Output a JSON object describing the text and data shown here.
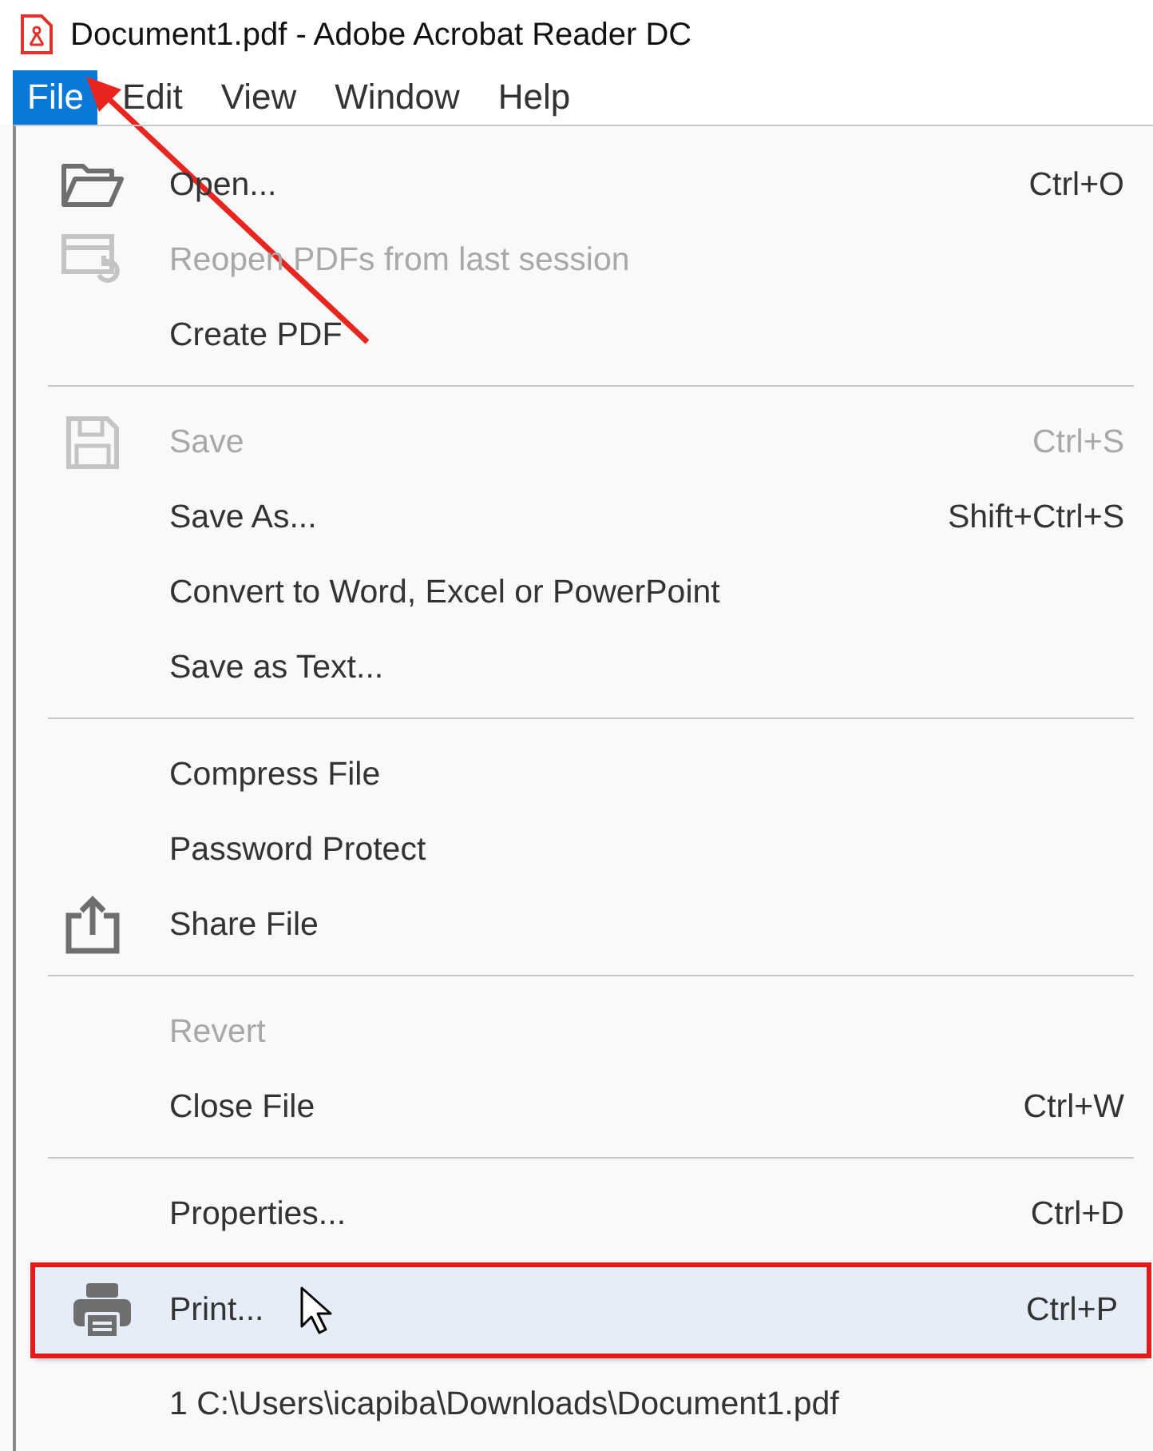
{
  "window": {
    "title": "Document1.pdf - Adobe Acrobat Reader DC"
  },
  "menu_bar": [
    {
      "label": "File",
      "selected": true
    },
    {
      "label": "Edit",
      "selected": false
    },
    {
      "label": "View",
      "selected": false
    },
    {
      "label": "Window",
      "selected": false
    },
    {
      "label": "Help",
      "selected": false
    }
  ],
  "file_menu": {
    "sections": [
      [
        {
          "label": "Open...",
          "shortcut": "Ctrl+O",
          "kind": "folder",
          "disabled": false,
          "selected": false
        },
        {
          "label": "Reopen PDFs from last session",
          "kind": "reopen",
          "disabled": true,
          "selected": false
        },
        {
          "label": "Create PDF",
          "disabled": false,
          "selected": false
        }
      ],
      [
        {
          "label": "Save",
          "shortcut": "Ctrl+S",
          "kind": "save",
          "disabled": true,
          "selected": false
        },
        {
          "label": "Save As...",
          "shortcut": "Shift+Ctrl+S",
          "disabled": false,
          "selected": false
        },
        {
          "label": "Convert to Word, Excel or PowerPoint",
          "disabled": false,
          "selected": false
        },
        {
          "label": "Save as Text...",
          "disabled": false,
          "selected": false
        }
      ],
      [
        {
          "label": "Compress File",
          "disabled": false,
          "selected": false
        },
        {
          "label": "Password Protect",
          "disabled": false,
          "selected": false
        },
        {
          "label": "Share File",
          "kind": "share",
          "disabled": false,
          "selected": false
        }
      ],
      [
        {
          "label": "Revert",
          "disabled": true,
          "selected": false
        },
        {
          "label": "Close File",
          "shortcut": "Ctrl+W",
          "disabled": false,
          "selected": false
        }
      ],
      [
        {
          "label": "Properties...",
          "shortcut": "Ctrl+D",
          "disabled": false,
          "selected": false
        },
        {
          "label": "Print...",
          "shortcut": "Ctrl+P",
          "kind": "print",
          "disabled": false,
          "selected": true,
          "highlighted": true,
          "pointer": true
        },
        {
          "label": "1 C:\\Users\\icapiba\\Downloads\\Document1.pdf",
          "disabled": false,
          "selected": false
        }
      ]
    ]
  }
}
